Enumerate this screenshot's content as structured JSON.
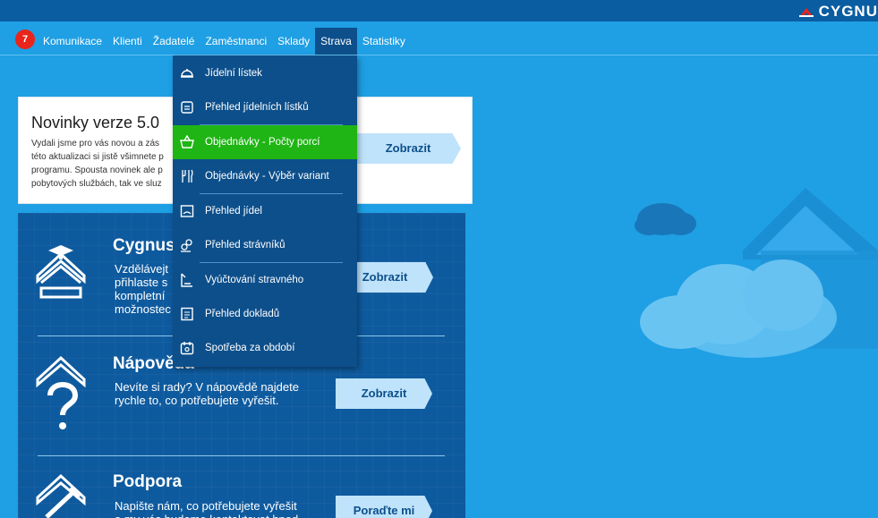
{
  "brand": {
    "name": "CYGNU",
    "accent": "#e8251c"
  },
  "nav": {
    "badge_count": "7",
    "items": [
      {
        "label": "Komunikace"
      },
      {
        "label": "Klienti"
      },
      {
        "label": "Žadatelé"
      },
      {
        "label": "Zaměstnanci"
      },
      {
        "label": "Sklady"
      },
      {
        "label": "Strava",
        "active": true
      },
      {
        "label": "Statistiky"
      }
    ]
  },
  "news": {
    "title": "Novinky verze 5.0",
    "text": "Vydali jsme pro vás novou a zás\ntéto aktualizaci si jistě všimnete p\nprogramu. Spousta novinek ale p\npobytových službách, tak ve sluz",
    "button": "Zobrazit"
  },
  "sections": [
    {
      "title": "Cygnus",
      "text": "Vzdělávejt\npřihlaste s\nkompletní\nmožnostec",
      "button": "Zobrazit",
      "icon": "graduation-house-icon"
    },
    {
      "title": "Nápověda",
      "text": "Nevíte si rady? V nápovědě najdete\nrychle to, co potřebujete vyřešit.",
      "button": "Zobrazit",
      "icon": "question-house-icon"
    },
    {
      "title": "Podpora",
      "text": "Napište nám, co potřebujete vyřešit\na my vás budeme kontaktovat hned",
      "button": "Poraďte mi",
      "icon": "tools-house-icon"
    }
  ],
  "menu": {
    "items": [
      {
        "label": "Jídelní lístek",
        "icon": "cloche-icon"
      },
      {
        "label": "Přehled jídelních lístků",
        "icon": "menu-board-icon"
      },
      {
        "label": "Objednávky - Počty porcí",
        "icon": "basket-icon",
        "selected": true
      },
      {
        "label": "Objednávky - Výběr variant",
        "icon": "cutlery-icon"
      },
      {
        "label": "Přehled jídel",
        "icon": "plate-icon"
      },
      {
        "label": "Přehled strávníků",
        "icon": "people-icon"
      },
      {
        "label": "Vyúčtování stravného",
        "icon": "invoice-icon"
      },
      {
        "label": "Přehled dokladů",
        "icon": "document-icon"
      },
      {
        "label": "Spotřeba za období",
        "icon": "calendar-icon"
      }
    ]
  },
  "colors": {
    "background": "#1f9fe4",
    "topbar": "#0a5da0",
    "menu_bg": "#0d4f8b",
    "menu_selected": "#1fb515",
    "button_bg": "#bfe3fb"
  }
}
